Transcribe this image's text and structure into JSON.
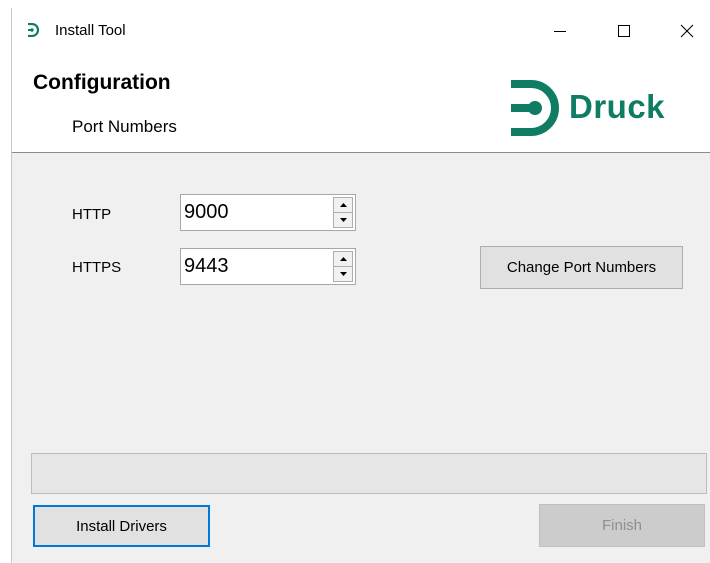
{
  "window": {
    "title": "Install Tool",
    "controls": [
      "minimize",
      "maximize",
      "close"
    ]
  },
  "header": {
    "title": "Configuration",
    "subtitle": "Port Numbers",
    "logo_text": "Druck",
    "brand_color": "#0f7c64"
  },
  "ports": {
    "http": {
      "label": "HTTP",
      "value": "9000"
    },
    "https": {
      "label": "HTTPS",
      "value": "9443"
    }
  },
  "buttons": {
    "change_ports": "Change Port Numbers",
    "install_drivers": "Install Drivers",
    "finish": "Finish"
  },
  "progress": {
    "value": 0
  }
}
